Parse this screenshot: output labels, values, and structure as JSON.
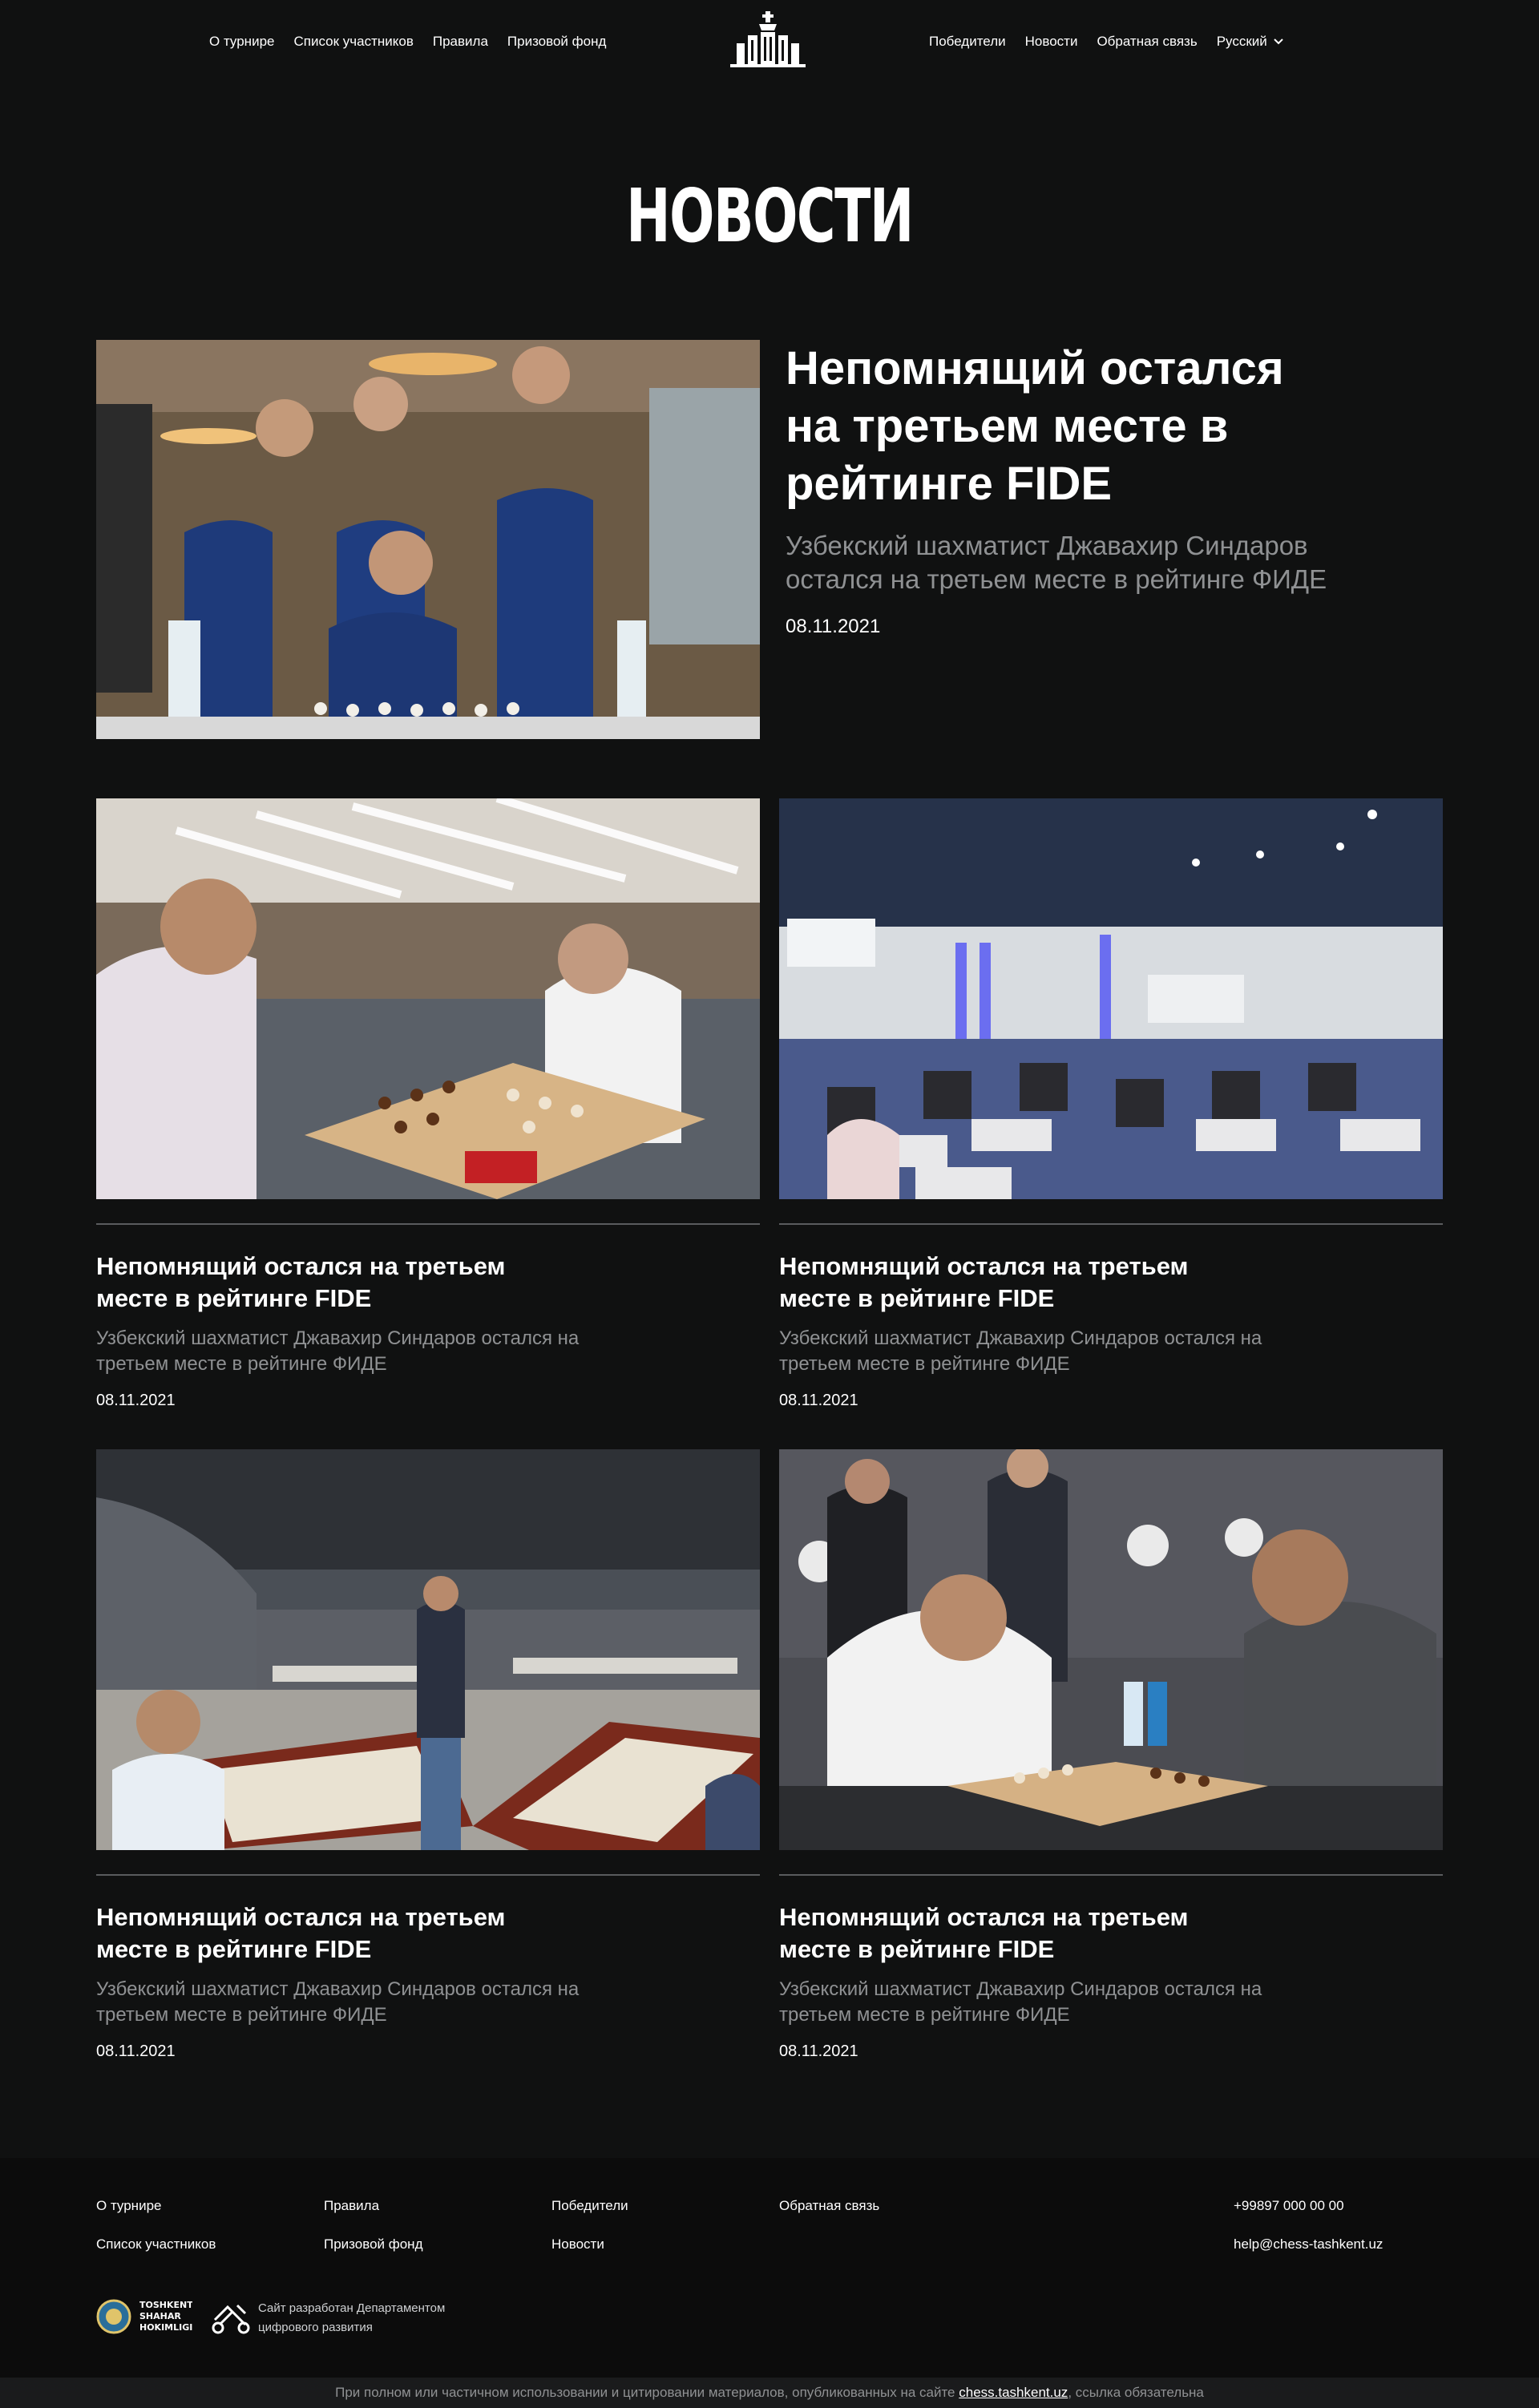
{
  "header": {
    "nav_left": [
      "О турнире",
      "Список участников",
      "Правила",
      "Призовой фонд"
    ],
    "nav_right": [
      "Победители",
      "Новости",
      "Обратная связь"
    ],
    "language": "Русский",
    "logo_icon": "chess-king-building-logo-icon"
  },
  "page": {
    "title": "НОВОСТИ"
  },
  "featured": {
    "title": "Непомнящий остался на третьем месте в рейтинге FIDE",
    "description": "Узбекский шахматист Джавахир Синдаров остался на третьем месте в рейтинге ФИДЕ",
    "date": "08.11.2021"
  },
  "cards": [
    {
      "title": "Непомнящий остался на третьем месте в рейтинге FIDE",
      "description": "Узбекский шахматист Джавахир Синдаров остался на третьем месте в рейтинге ФИДЕ",
      "date": "08.11.2021"
    },
    {
      "title": "Непомнящий остался на третьем месте в рейтинге FIDE",
      "description": "Узбекский шахматист Джавахир Синдаров остался на третьем месте в рейтинге ФИДЕ",
      "date": "08.11.2021"
    },
    {
      "title": "Непомнящий остался на третьем месте в рейтинге FIDE",
      "description": "Узбекский шахматист Джавахир Синдаров остался на третьем месте в рейтинге ФИДЕ",
      "date": "08.11.2021"
    },
    {
      "title": "Непомнящий остался на третьем месте в рейтинге FIDE",
      "description": "Узбекский шахматист Джавахир Синдаров остался на третьем месте в рейтинге ФИДЕ",
      "date": "08.11.2021"
    }
  ],
  "footer": {
    "links": {
      "about": "О турнире",
      "participants": "Список участников",
      "rules": "Правила",
      "prize": "Призовой фонд",
      "winners": "Победители",
      "news": "Новости",
      "feedback": "Обратная связь"
    },
    "phone": "+99897 000 00 00",
    "email": "help@chess-tashkent.uz",
    "hokimligi_logo": "TOSHKENT SHAHAR HOKIMLIGI",
    "developer": "Сайт разработан Департаментом цифрового развития",
    "copyright_prefix": "При полном или частичном использовании и цитировании материалов, опубликованных на сайте",
    "copyright_link": "chess.tashkent.uz",
    "copyright_suffix": ", ссылка обязательна"
  },
  "colors": {
    "background": "#101111",
    "muted_text": "#8f9193",
    "divider": "#5a5c5e"
  }
}
